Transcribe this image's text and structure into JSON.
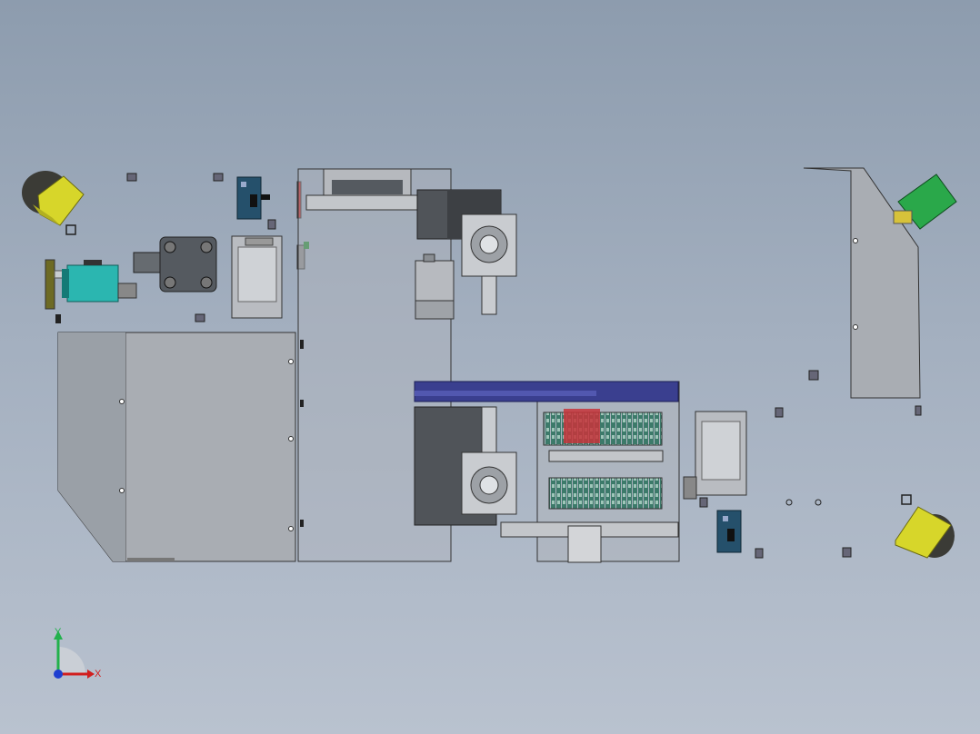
{
  "viewport": {
    "background_top": "#8d9cae",
    "background_bottom": "#b9c2cf"
  },
  "triad": {
    "x_label": "X",
    "y_label": "Y",
    "x_color": "#d11f1f",
    "y_color": "#22b14c",
    "z_color": "#1f3fd1"
  },
  "colors": {
    "sheet_metal": "#a9adb3",
    "sheet_metal_transparent": "rgba(175,180,188,0.55)",
    "motor_dark": "#555a60",
    "camera_yellow": "#d7d62a",
    "solenoid_teal": "#2bb6b0",
    "pcb_green": "#2aa84a",
    "pcb_blue": "#25506b",
    "din_rail_blue": "#3a3f8f",
    "terminal_green": "#3c7a6a",
    "relay_red": "#c7343a"
  },
  "icons": [
    "axis-triad-icon"
  ]
}
